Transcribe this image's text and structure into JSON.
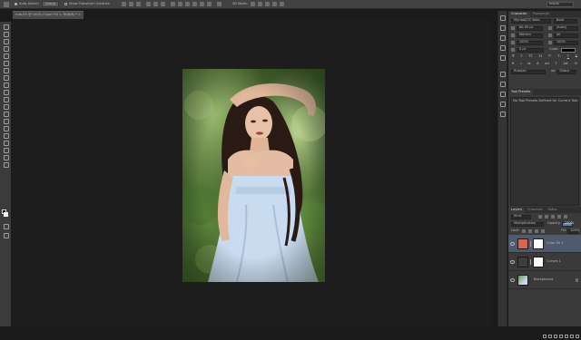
{
  "options_bar": {
    "auto_select_label": "Auto-Select:",
    "auto_select_value": "Group",
    "transform_controls_label": "Show Transform Controls",
    "mode_label": "3D Mode:",
    "workspace": "Inkpix"
  },
  "document": {
    "tab_title": "tuts-05 @ 100% (Color Fill 1, RGB/8) *",
    "close": "×"
  },
  "character_panel": {
    "tabs": [
      "Character",
      "Paragraph"
    ],
    "font_family": "Myriad/LTC Bold",
    "font_style": "Bold",
    "font_size": "80.09 pt",
    "leading": "(Auto)",
    "kerning": "Metrics",
    "tracking": "40",
    "vert_scale": "100%",
    "horiz_scale": "100%",
    "baseline": "0 pt",
    "color_label": "Color:",
    "color": "#000000",
    "style_glyphs": [
      "T",
      "T",
      "TT",
      "Tt",
      "T¹",
      "T₁",
      "T",
      "T"
    ],
    "opentype_glyphs": [
      "fi",
      "ℴ",
      "st",
      "A",
      "ad",
      "T",
      "1st",
      "½"
    ],
    "language": "Russian",
    "aa_label": "aa",
    "aa_value": "Sharp"
  },
  "tool_presets": {
    "tab": "Tool Presets",
    "empty_message": "No Tool Presets Defined for Current Tool.",
    "footer": "Current Tool Only"
  },
  "layers_panel": {
    "tabs": [
      "Layers",
      "Channels",
      "Paths"
    ],
    "filter_kind": "Kind",
    "blend_mode": "Multiplication",
    "opacity_label": "Opacity:",
    "opacity": "100%",
    "lock_label": "Lock:",
    "fill_label": "Fill:",
    "fill": "100%",
    "layers": [
      {
        "name": "Color Fill 1",
        "thumb_color": "#d9634f",
        "selected": true,
        "has_mask": true
      },
      {
        "name": "Curves 1",
        "thumb_color": "#3c3c3c",
        "selected": false,
        "has_mask": true
      },
      {
        "name": "Background",
        "thumb_color": "#5b7b45",
        "selected": false,
        "has_mask": false
      }
    ]
  }
}
